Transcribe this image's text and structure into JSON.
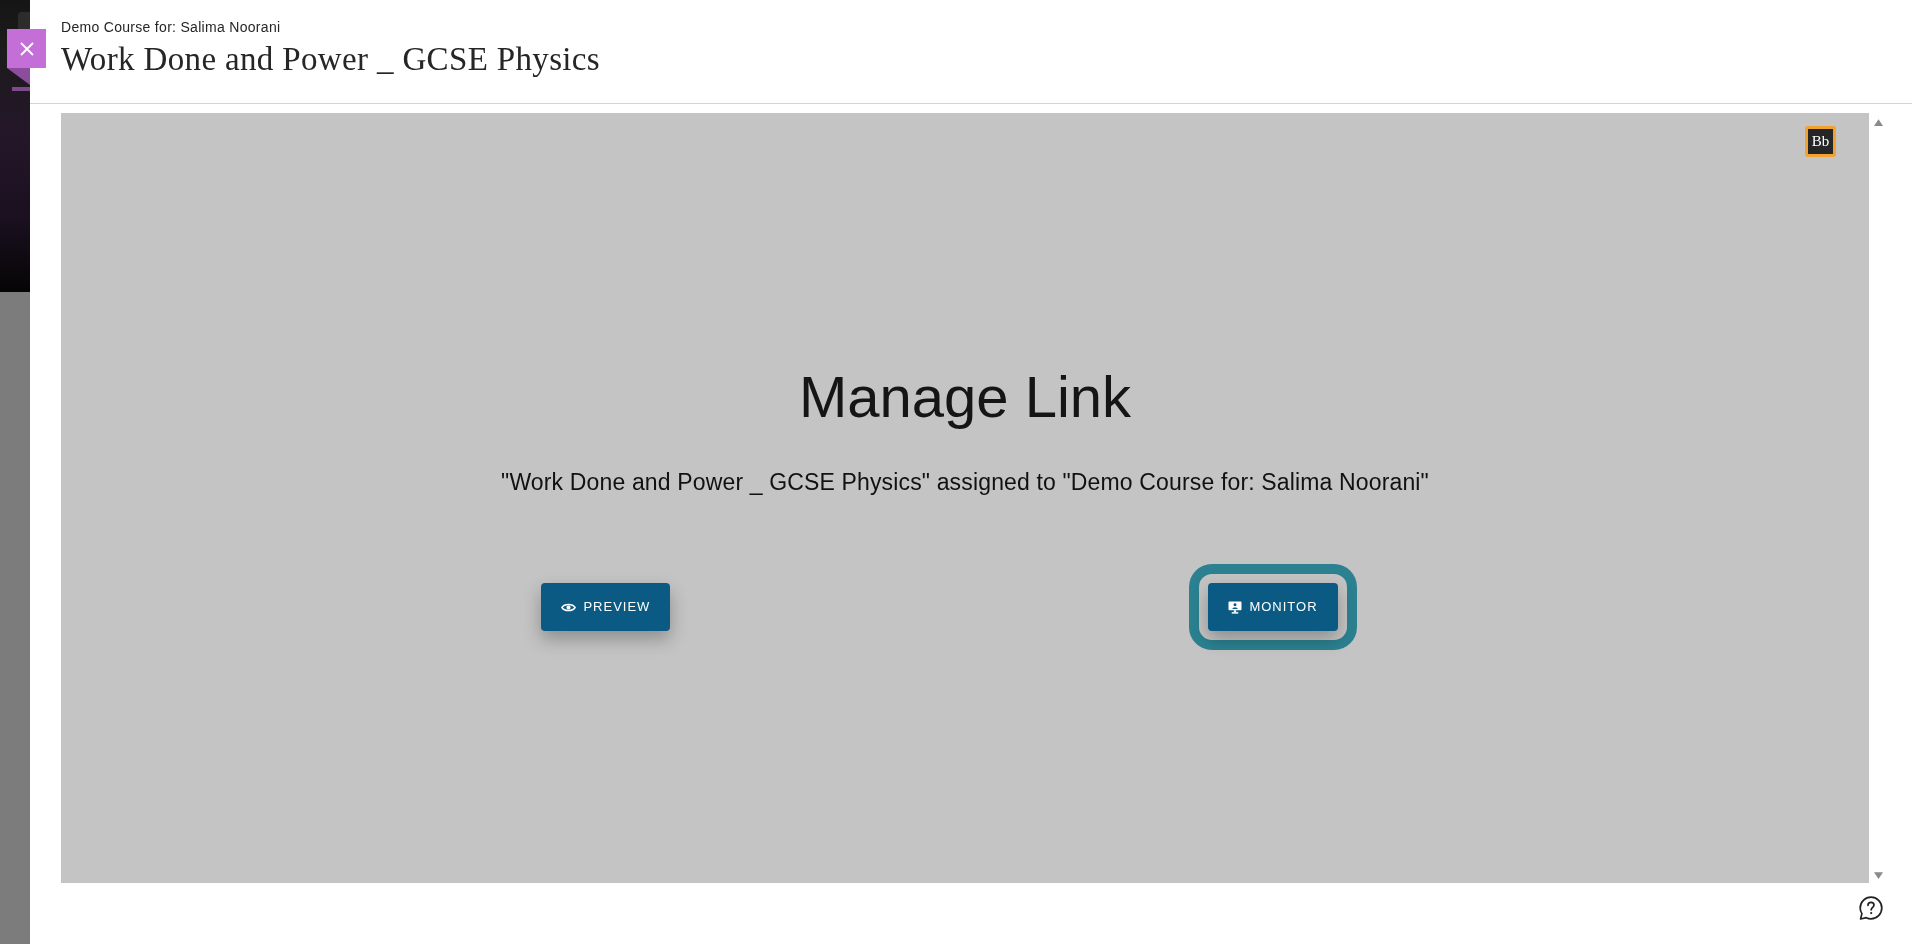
{
  "dialog": {
    "course_label": "Demo Course for: Salima Noorani",
    "title": "Work Done and Power _ GCSE Physics"
  },
  "frame": {
    "logo_text": "Bb",
    "heading": "Manage Link",
    "message": "\"Work Done and Power _ GCSE Physics\" assigned to \"Demo Course for: Salima Noorani\"",
    "buttons": [
      {
        "label": "PREVIEW",
        "kind": "preview",
        "focused": false
      },
      {
        "label": "MONITOR",
        "kind": "monitor",
        "focused": true
      }
    ]
  }
}
